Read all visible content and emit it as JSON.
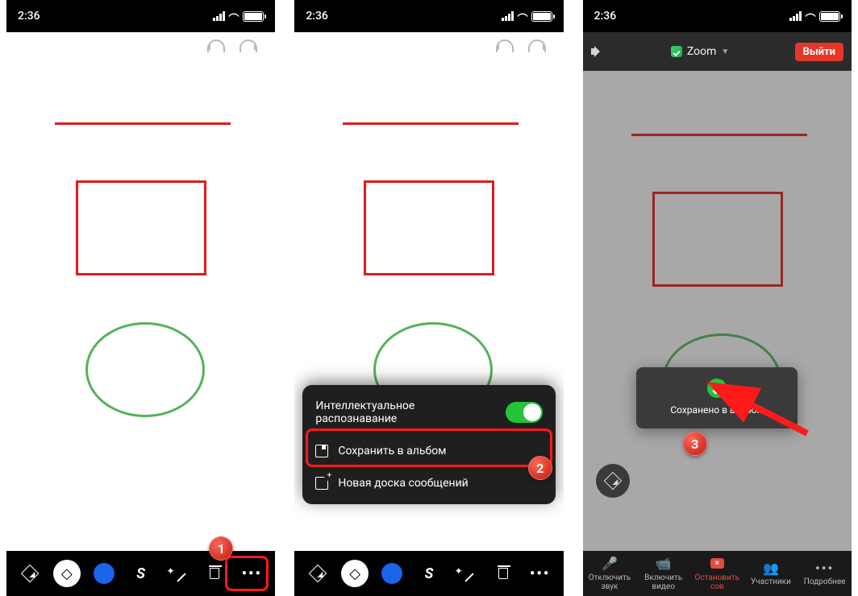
{
  "status": {
    "time": "2:36"
  },
  "toolbar_items": [
    "pencil",
    "eraser",
    "color",
    "bolt",
    "wand",
    "trash",
    "more"
  ],
  "popup": {
    "smart_recognition": "Интеллектуальное\nраспознавание",
    "save_album": "Сохранить в альбом",
    "new_board": "Новая доска сообщений"
  },
  "meeting": {
    "title": "Zoom",
    "exit": "Выйти",
    "toast": "Сохранено в альбом",
    "bottom": {
      "mute": "Отключить звук",
      "video": "Включить видео",
      "stop": "Остановить сов",
      "participants": "Участники",
      "more": "Подробнее"
    }
  },
  "steps": {
    "s1": "1",
    "s2": "2",
    "s3": "3"
  }
}
